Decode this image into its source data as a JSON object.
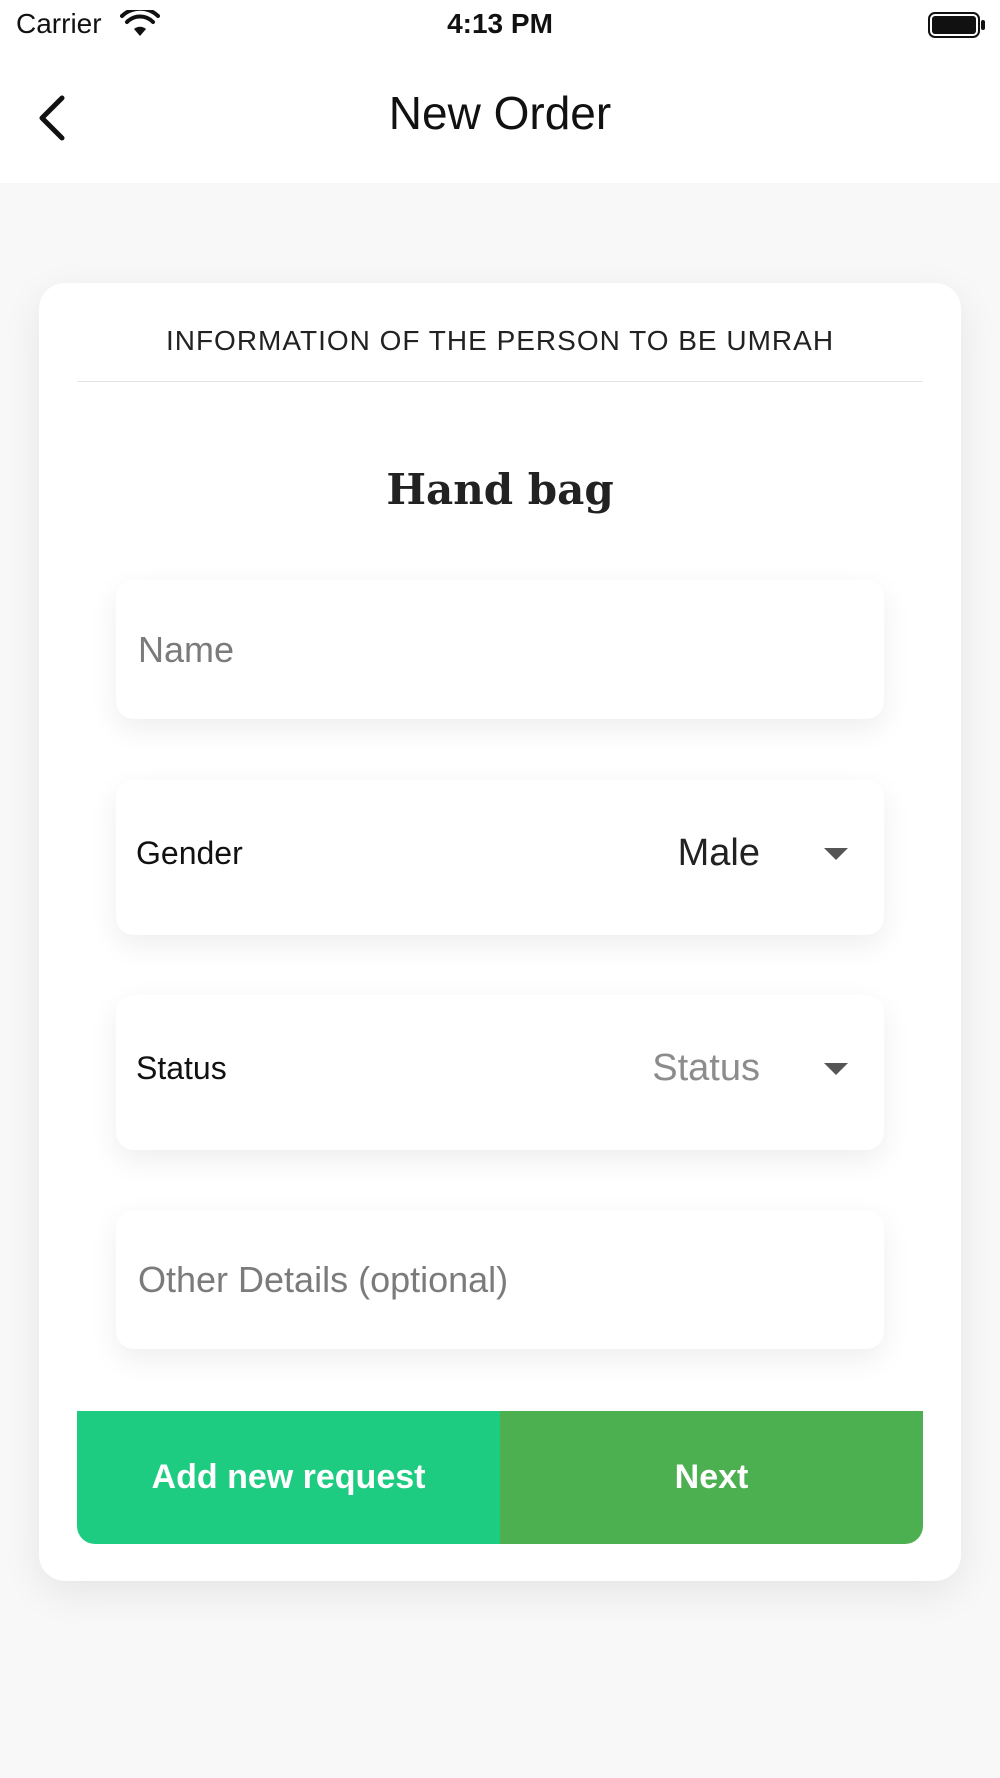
{
  "status_bar": {
    "carrier": "Carrier",
    "time": "4:13 PM",
    "icons": [
      "wifi-icon",
      "battery-icon"
    ]
  },
  "nav": {
    "title": "New Order",
    "back_icon": "chevron-left-icon"
  },
  "form": {
    "section_title": "INFORMATION OF THE PERSON TO BE UMRAH",
    "item_title": "Hand bag",
    "name": {
      "placeholder": "Name",
      "value": ""
    },
    "gender": {
      "label": "Gender",
      "value": "Male",
      "icon": "dropdown-arrow-icon"
    },
    "status": {
      "label": "Status",
      "value": "Status",
      "icon": "dropdown-arrow-icon"
    },
    "details": {
      "placeholder": "Other Details (optional)",
      "value": ""
    }
  },
  "actions": {
    "add_label": "Add new request",
    "next_label": "Next"
  },
  "colors": {
    "add_button": "#1dcb81",
    "next_button": "#4cb050",
    "background": "#f8f8f8"
  }
}
